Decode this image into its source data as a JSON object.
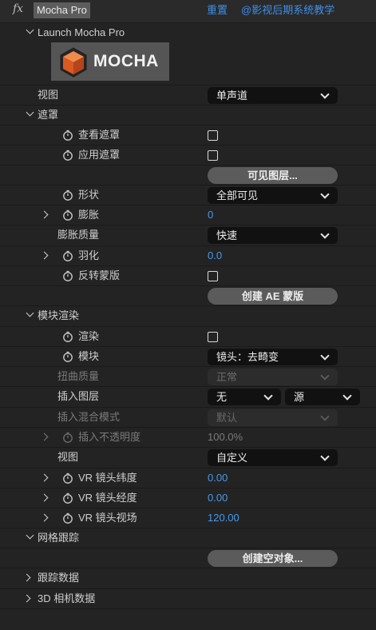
{
  "header": {
    "fx_symbol": "fx",
    "effect_name": "Mocha Pro",
    "reset": "重置",
    "credit": "@影视后期系统教学"
  },
  "launch": {
    "label": "Launch Mocha Pro",
    "logo_text": "MOCHA"
  },
  "view_row": {
    "label": "视图",
    "value": "单声道"
  },
  "mask_section": {
    "label": "遮罩",
    "view_mask": "查看遮罩",
    "apply_mask": "应用遮罩",
    "visible_layers_button": "可见图层...",
    "shape_label": "形状",
    "shape_value": "全部可见",
    "expand_label": "膨胀",
    "expand_value": "0",
    "expand_quality_label": "膨胀质量",
    "expand_quality_value": "快速",
    "feather_label": "羽化",
    "feather_value": "0.0",
    "invert_label": "反转蒙版",
    "create_ae_mask_button": "创建 AE 蒙版"
  },
  "module_section": {
    "label": "模块渲染",
    "render_label": "渲染",
    "module_label": "模块",
    "module_value": "镜头：去畸变",
    "distortion_quality_label": "扭曲质量",
    "distortion_quality_value": "正常",
    "insert_layer_label": "插入图层",
    "insert_layer_value": "无",
    "insert_source_value": "源",
    "insert_blend_label": "插入混合模式",
    "insert_blend_value": "默认",
    "insert_opacity_label": "插入不透明度",
    "insert_opacity_value": "100.0%",
    "view_label": "视图",
    "view_value": "自定义",
    "vr_lat_label": "VR 镜头纬度",
    "vr_lat_value": "0.00",
    "vr_lon_label": "VR 镜头经度",
    "vr_lon_value": "0.00",
    "vr_fov_label": "VR 镜头视场",
    "vr_fov_value": "120.00"
  },
  "mesh_section": {
    "label": "网格跟踪",
    "create_null_button": "创建空对象..."
  },
  "tracking_data": {
    "label": "跟踪数据"
  },
  "camera_data": {
    "label": "3D 相机数据"
  },
  "colors": {
    "accent_blue": "#3f8fe6",
    "value_blue": "#4a98ea",
    "logo_cube": "#e0632a"
  }
}
